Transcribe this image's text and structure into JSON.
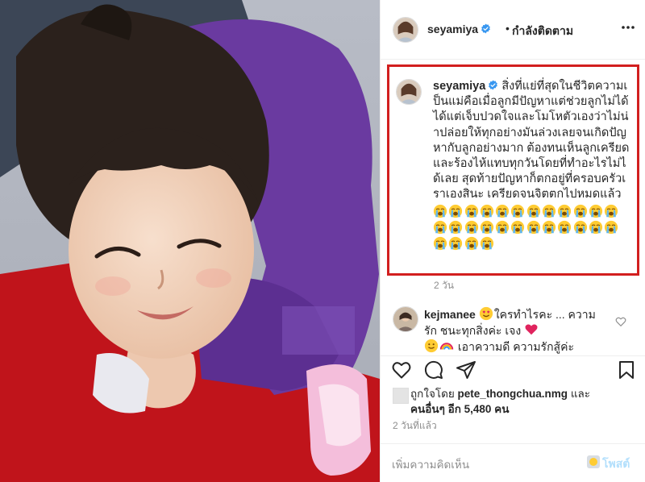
{
  "post": {
    "username": "seyamiya",
    "verified_icon": "verified-badge-icon",
    "dot": "•",
    "follow_status": "กำลังติดตาม",
    "more_icon": "more-horizontal-icon"
  },
  "caption": {
    "username": "seyamiya",
    "text": "สิ่งที่แย่ที่สุดในชีวิตความเป็นแม่คือเมื่อลูกมีปัญหาแต่ช่วยลูกไม่ได้ ได้แต่เจ็บปวดใจและโมโหตัวเองว่าไม่น่าปล่อยให้ทุกอย่างมันล่วงเลยจนเกิดปัญหากับลูกอย่างมาก ต้องทนเห็นลูกเครียดและร้องไห้แทบทุกวันโดยที่ทำอะไรไม่ได้เลย สุดท้ายปัญหาก็ตกอยู่ที่ครอบครัวเราเองสินะ เครียดจนจิตตกไปหมดแล้ว",
    "emoji_icon": "loudly-crying-face-emoji",
    "emoji_count": 28,
    "time_ago": "2 วัน",
    "highlight_color": "#d21f1f"
  },
  "comment": {
    "username": "kejmanee",
    "text": "ใครทำไรคะ ... ความรัก ชนะทุกสิ่งค่ะ เจง",
    "text2": "เอาความดี ความรักสู้ค่ะ",
    "heart_icon": "heart-outline-icon"
  },
  "actions": {
    "like_icon": "heart-icon",
    "comment_icon": "comment-icon",
    "share_icon": "share-icon",
    "save_icon": "bookmark-icon"
  },
  "likes": {
    "prefix": "ถูกใจโดย",
    "liker": "pete_thongchua.nmg",
    "and": "และ",
    "others_label": "คนอื่นๆ อีก 5,480 คน"
  },
  "posted_ago": "2 วันที่แล้ว",
  "add_comment": {
    "placeholder": "เพิ่มความคิดเห็น",
    "post_label": "โพสต์"
  },
  "colors": {
    "accent_blue": "#3897f0",
    "post_button_disabled": "#b2dffc",
    "secondary_text": "#8e8e8e"
  }
}
